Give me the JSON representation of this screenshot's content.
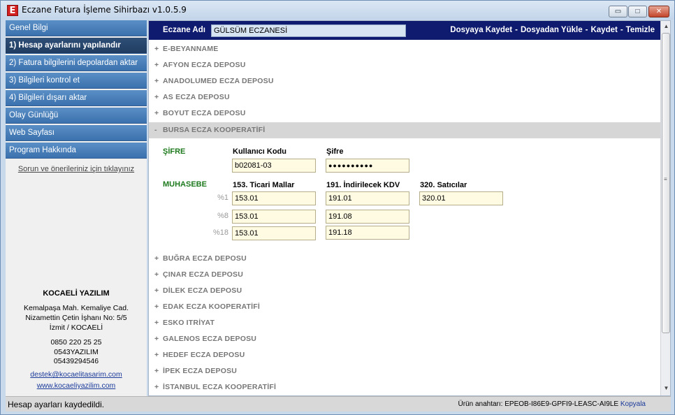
{
  "window": {
    "title": "Eczane Fatura İşleme Sihirbazı v1.0.5.9",
    "icon_letter": "E",
    "minimize_glyph": "▭",
    "maximize_glyph": "□",
    "close_glyph": "✕"
  },
  "sidebar": {
    "items": [
      {
        "label": "Genel Bilgi"
      },
      {
        "label": "1) Hesap ayarlarını yapılandır"
      },
      {
        "label": "2) Fatura bilgilerini depolardan aktar"
      },
      {
        "label": "3) Bilgileri kontrol et"
      },
      {
        "label": "4) Bilgileri dışarı aktar"
      },
      {
        "label": "Olay Günlüğü"
      },
      {
        "label": "Web Sayfası"
      },
      {
        "label": "Program Hakkında"
      }
    ],
    "feedback_link": "Sorun ve önerileriniz için tıklayınız",
    "company": {
      "name": "KOCAELİ YAZILIM",
      "address1": "Kemalpaşa Mah. Kemaliye Cad.",
      "address2": "Nizamettin Çetin İşhanı No: 5/5",
      "address3": "İzmit / KOCAELİ",
      "phone1": "0850 220 25 25",
      "phone2": "0543YAZILIM",
      "phone3": "05439294546",
      "email": "destek@kocaelitasarim.com",
      "website": "www.kocaeliyazilim.com"
    }
  },
  "topbar": {
    "eczane_label": "Eczane Adı",
    "eczane_value": "GÜLSÜM ECZANESİ",
    "links": [
      "Dosyaya Kaydet",
      "Dosyadan Yükle",
      "Kaydet",
      "Temizle"
    ],
    "separator": "-"
  },
  "depots_before": [
    {
      "sym": "+",
      "name": "E-BEYANNAME"
    },
    {
      "sym": "+",
      "name": "AFYON ECZA DEPOSU"
    },
    {
      "sym": "+",
      "name": "ANADOLUMED ECZA DEPOSU"
    },
    {
      "sym": "+",
      "name": "AS ECZA DEPOSU"
    },
    {
      "sym": "+",
      "name": "BOYUT ECZA DEPOSU"
    },
    {
      "sym": "-",
      "name": "BURSA ECZA KOOPERATİFİ"
    }
  ],
  "expanded": {
    "sifre_title": "ŞİFRE",
    "kullanici_label": "Kullanıcı Kodu",
    "kullanici_value": "b02081-03",
    "sifre_label": "Şifre",
    "sifre_value": "●●●●●●●●●●",
    "muhasebe_title": "MUHASEBE",
    "col1_label": "153. Ticari Mallar",
    "col2_label": "191. İndirilecek KDV",
    "col3_label": "320. Satıcılar",
    "rows": [
      {
        "pct": "%1",
        "c1": "153.01",
        "c2": "191.01",
        "c3": "320.01"
      },
      {
        "pct": "%8",
        "c1": "153.01",
        "c2": "191.08"
      },
      {
        "pct": "%18",
        "c1": "153.01",
        "c2": "191.18"
      }
    ]
  },
  "depots_after": [
    {
      "sym": "+",
      "name": "BUĞRA ECZA DEPOSU"
    },
    {
      "sym": "+",
      "name": "ÇINAR ECZA DEPOSU"
    },
    {
      "sym": "+",
      "name": "DİLEK ECZA DEPOSU"
    },
    {
      "sym": "+",
      "name": "EDAK ECZA KOOPERATİFİ"
    },
    {
      "sym": "+",
      "name": "ESKO ITRİYAT"
    },
    {
      "sym": "+",
      "name": "GALENOS ECZA DEPOSU"
    },
    {
      "sym": "+",
      "name": "HEDEF ECZA DEPOSU"
    },
    {
      "sym": "+",
      "name": "İPEK ECZA DEPOSU"
    },
    {
      "sym": "+",
      "name": "İSTANBUL ECZA KOOPERATİFİ"
    }
  ],
  "status": {
    "message": "Hesap ayarları kaydedildi.",
    "product_key_label": "Ürün anahtarı:",
    "product_key": "EPEOB-I86E9-GPFI9-LEASC-AI9LE",
    "copy_label": "Kopyala"
  }
}
